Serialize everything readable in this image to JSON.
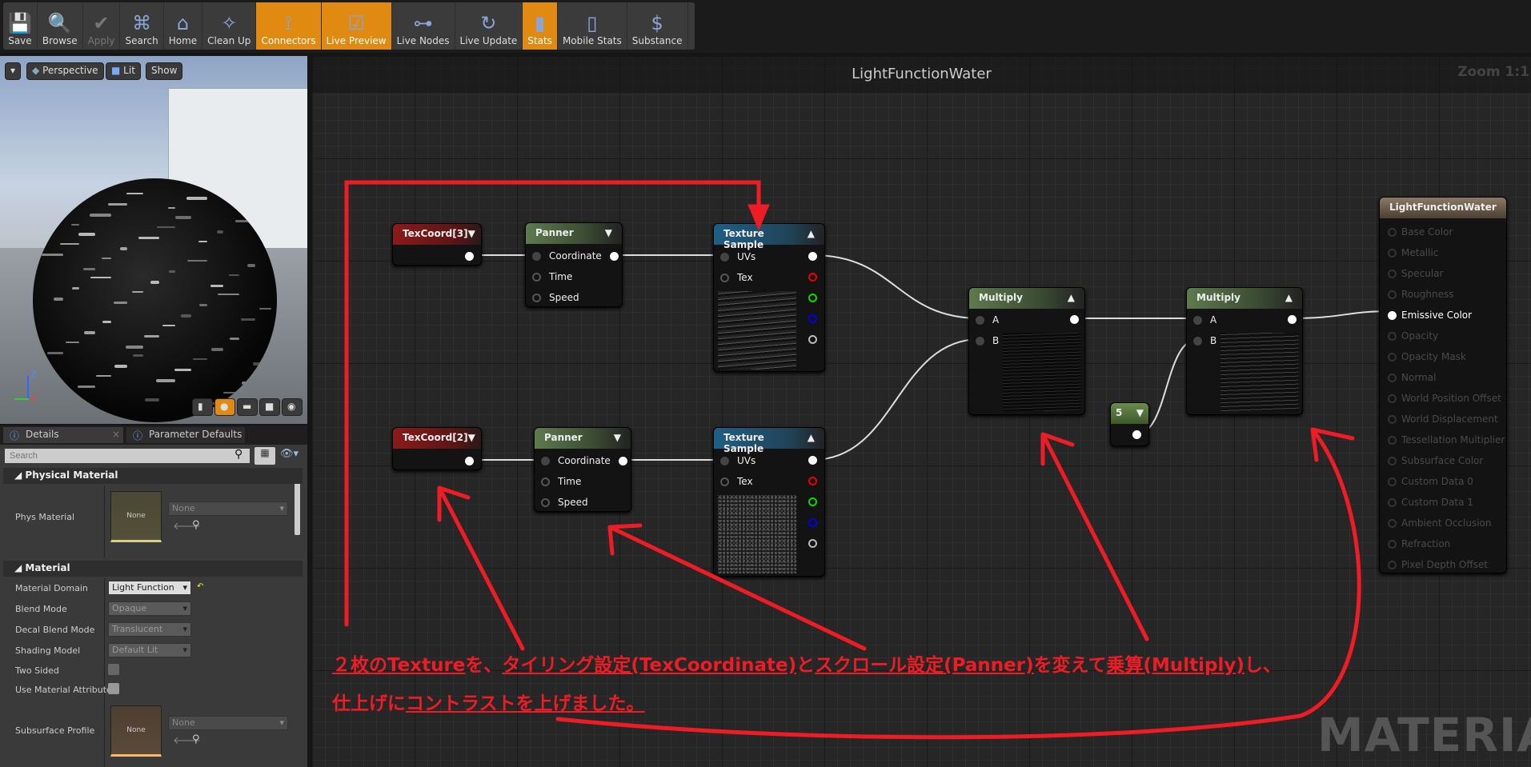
{
  "toolbar": {
    "buttons": [
      {
        "label": "Save",
        "icon": "floppy-icon",
        "state": "normal"
      },
      {
        "label": "Browse",
        "icon": "magnifier-icon",
        "state": "normal"
      },
      {
        "label": "Apply",
        "icon": "checkmark-icon",
        "state": "disabled"
      },
      {
        "label": "Search",
        "icon": "binoculars-icon",
        "state": "normal"
      },
      {
        "label": "Home",
        "icon": "home-icon",
        "state": "normal"
      },
      {
        "label": "Clean Up",
        "icon": "broom-icon",
        "state": "normal"
      },
      {
        "label": "Connectors",
        "icon": "connectors-icon",
        "state": "active"
      },
      {
        "label": "Live Preview",
        "icon": "tv-icon",
        "state": "active"
      },
      {
        "label": "Live Nodes",
        "icon": "live-nodes-icon",
        "state": "normal"
      },
      {
        "label": "Live Update",
        "icon": "live-update-icon",
        "state": "normal"
      },
      {
        "label": "Stats",
        "icon": "bar-chart-icon",
        "state": "active"
      },
      {
        "label": "Mobile Stats",
        "icon": "mobile-stats-icon",
        "state": "normal"
      },
      {
        "label": "Substance",
        "icon": "substance-icon",
        "state": "normal"
      }
    ],
    "active_color": "#e08a12"
  },
  "viewport": {
    "perspective": "Perspective",
    "lit": "Lit",
    "show": "Show",
    "axes": {
      "z": "Z",
      "x": "X"
    }
  },
  "details": {
    "tabs": [
      {
        "label": "Details"
      },
      {
        "label": "Parameter Defaults"
      }
    ],
    "search_placeholder": "Search",
    "physical_material": {
      "header": "Physical Material",
      "phys_material_label": "Phys Material",
      "thumb": "None",
      "value": "None"
    },
    "material": {
      "header": "Material",
      "material_domain": {
        "label": "Material Domain",
        "value": "Light Function"
      },
      "blend_mode": {
        "label": "Blend Mode",
        "value": "Opaque"
      },
      "decal_blend_mode": {
        "label": "Decal Blend Mode",
        "value": "Translucent"
      },
      "shading_model": {
        "label": "Shading Model",
        "value": "Default Lit"
      },
      "two_sided": {
        "label": "Two Sided",
        "checked": false
      },
      "use_material_attributes": {
        "label": "Use Material Attribute",
        "checked": false
      },
      "subsurface_profile": {
        "label": "Subsurface Profile",
        "thumb": "None",
        "value": "None"
      }
    }
  },
  "graph": {
    "title": "LightFunctionWater",
    "zoom": "Zoom 1:1",
    "nodes": {
      "texcoord3": "TexCoord[3]",
      "texcoord2": "TexCoord[2]",
      "panner": {
        "title": "Panner",
        "coordinate": "Coordinate",
        "time": "Time",
        "speed": "Speed"
      },
      "texture_sample": {
        "title": "Texture Sample",
        "uvs": "UVs",
        "tex": "Tex"
      },
      "multiply": {
        "title": "Multiply",
        "a": "A",
        "b": "B"
      },
      "constant": "5",
      "output": {
        "title": "LightFunctionWater",
        "pins": [
          "Base Color",
          "Metallic",
          "Specular",
          "Roughness",
          "Emissive Color",
          "Opacity",
          "Opacity Mask",
          "Normal",
          "World Position Offset",
          "World Displacement",
          "Tessellation Multiplier",
          "Subsurface Color",
          "Custom Data 0",
          "Custom Data 1",
          "Ambient Occlusion",
          "Refraction",
          "Pixel Depth Offset"
        ],
        "active_pin": "Emissive Color"
      }
    }
  },
  "annotation": {
    "line1": [
      "２枚のTexture",
      "を、",
      "タイリング設定(TexCoordinate)",
      "と",
      "スクロール設定(Panner)",
      "を変えて",
      "乗算(Multiply)",
      "し、"
    ],
    "line2": [
      "仕上げに",
      "コントラストを上げました。"
    ],
    "color": "#ee1c25"
  },
  "watermark": "MATERIAL"
}
